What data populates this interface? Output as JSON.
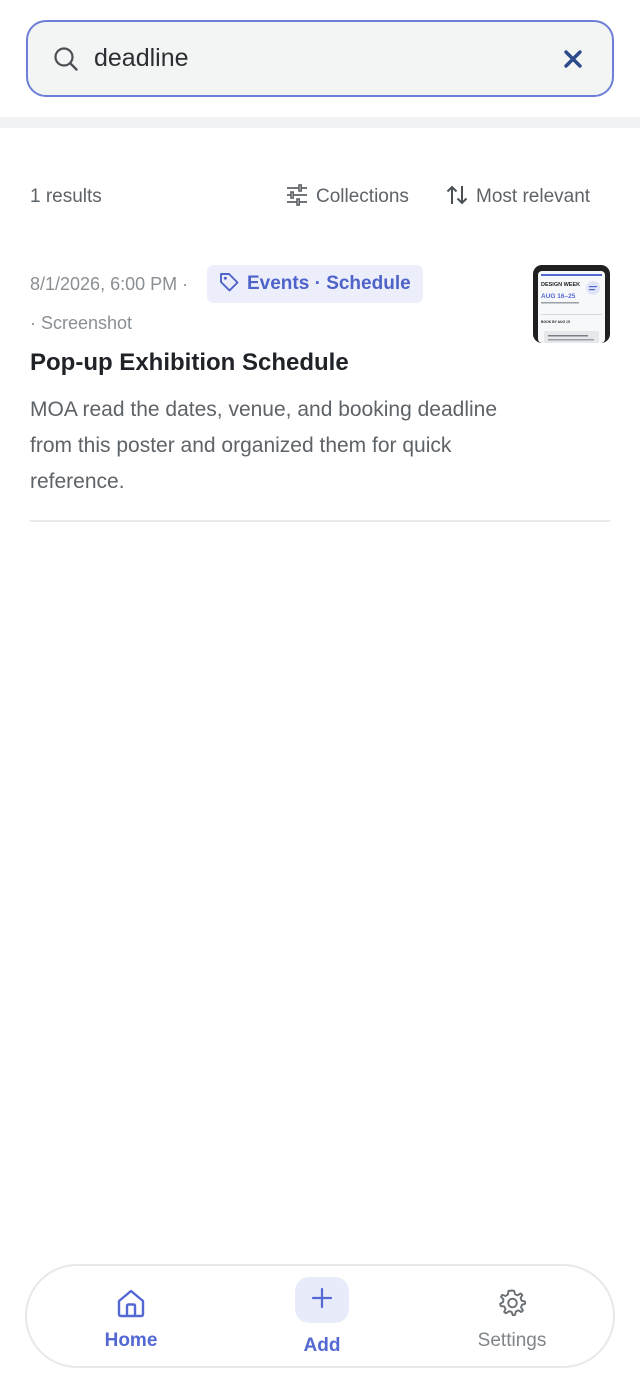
{
  "search": {
    "value": "deadline"
  },
  "results": {
    "count_label": "1 results",
    "collections_label": "Collections",
    "sort_label": "Most relevant"
  },
  "result_items": [
    {
      "date": "8/1/2026, 6:00 PM ·",
      "tag": "Events · Schedule",
      "source": "· Screenshot",
      "title": "Pop-up Exhibition Schedule",
      "description": "MOA read the dates, venue, and booking deadline from this poster and organized them for quick reference.",
      "thumbnail": {
        "heading": "DESIGN WEEK",
        "dates": "AUG 16–25",
        "book_by": "BOOK BY AUG 15"
      }
    }
  ],
  "nav": {
    "home_label": "Home",
    "add_label": "Add",
    "settings_label": "Settings"
  },
  "colors": {
    "accent": "#5468d4",
    "tag_bg": "#eceefb",
    "search_border": "#6c7fd8"
  }
}
